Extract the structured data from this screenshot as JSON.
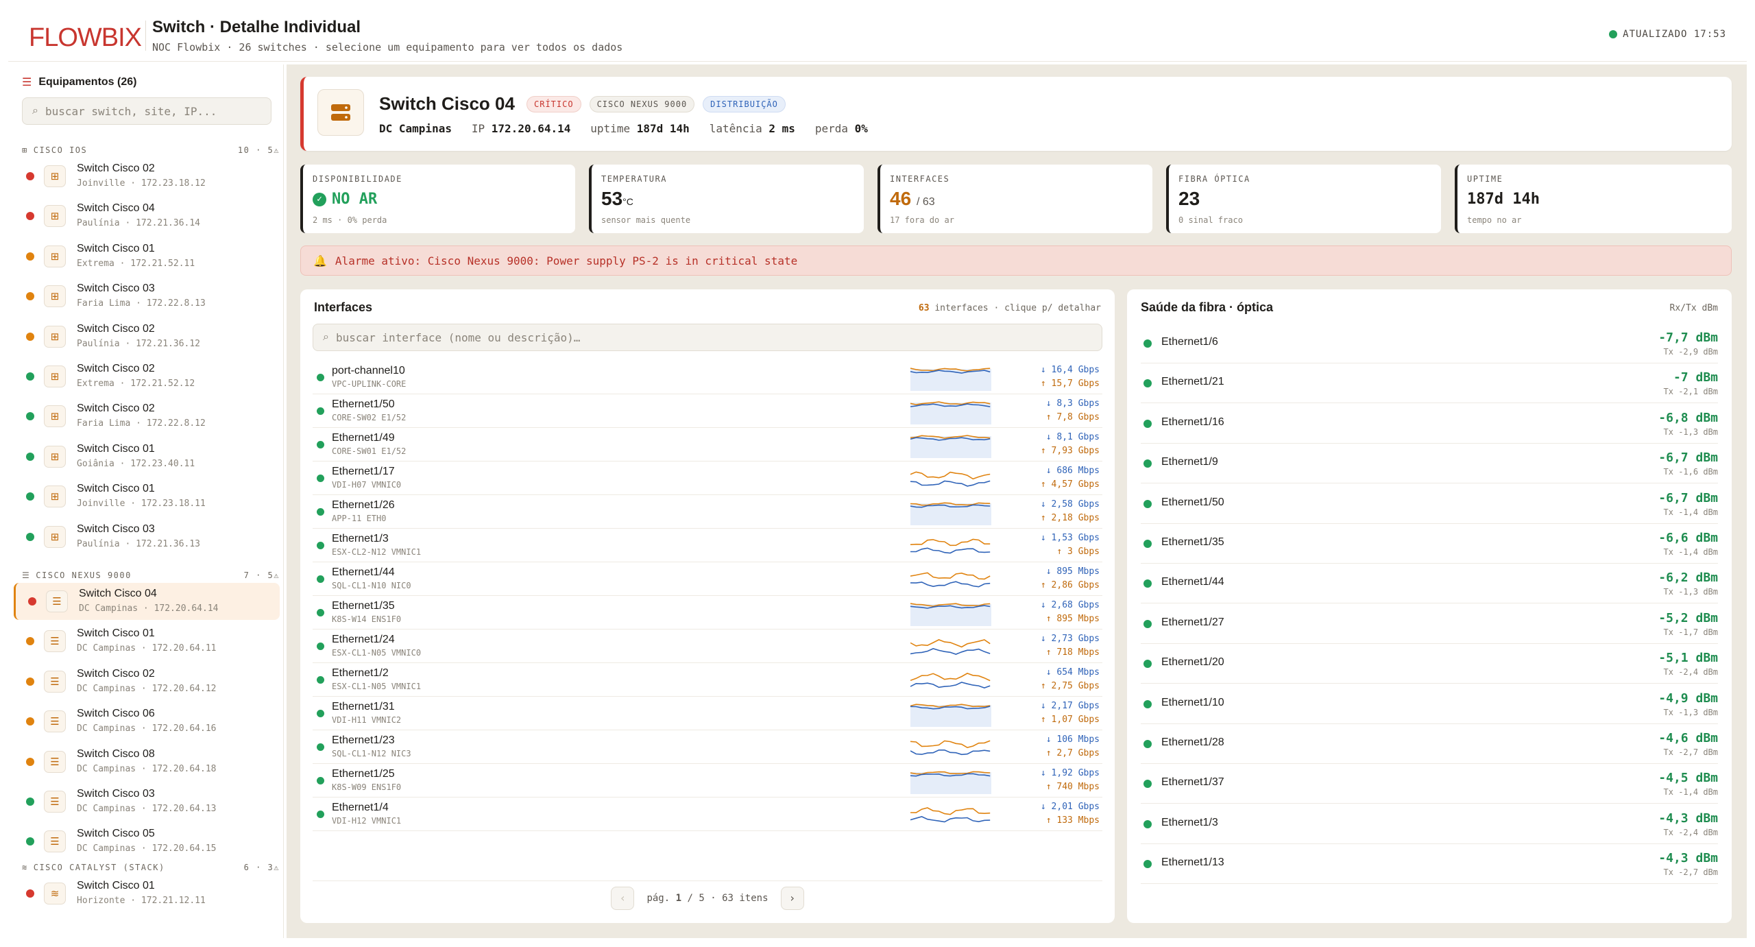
{
  "header": {
    "logo": "FLOWBIX",
    "title": "Switch · Detalhe Individual",
    "subtitle": "NOC Flowbix · 26 switches · selecione um equipamento para ver todos os dados",
    "updated": "ATUALIZADO 17:53"
  },
  "sidebar": {
    "title": "Equipamentos (26)",
    "search_placeholder": "buscar switch, site, IP...",
    "groups": [
      {
        "label": "CISCO IOS",
        "count": "10 · 5⚠",
        "icon": "network-icon",
        "items": [
          {
            "name": "Switch Cisco 02",
            "sub": "Joinville · 172.23.18.12",
            "status": "#d6392f"
          },
          {
            "name": "Switch Cisco 04",
            "sub": "Paulínia · 172.21.36.14",
            "status": "#d6392f"
          },
          {
            "name": "Switch Cisco 01",
            "sub": "Extrema · 172.21.52.11",
            "status": "#e0830f"
          },
          {
            "name": "Switch Cisco 03",
            "sub": "Faria Lima · 172.22.8.13",
            "status": "#e0830f"
          },
          {
            "name": "Switch Cisco 02",
            "sub": "Paulínia · 172.21.36.12",
            "status": "#e0830f"
          },
          {
            "name": "Switch Cisco 02",
            "sub": "Extrema · 172.21.52.12",
            "status": "#22a05b"
          },
          {
            "name": "Switch Cisco 02",
            "sub": "Faria Lima · 172.22.8.12",
            "status": "#22a05b"
          },
          {
            "name": "Switch Cisco 01",
            "sub": "Goiânia · 172.23.40.11",
            "status": "#22a05b"
          },
          {
            "name": "Switch Cisco 01",
            "sub": "Joinville · 172.23.18.11",
            "status": "#22a05b"
          },
          {
            "name": "Switch Cisco 03",
            "sub": "Paulínia · 172.21.36.13",
            "status": "#22a05b"
          }
        ]
      },
      {
        "label": "CISCO NEXUS 9000",
        "count": "7 · 5⚠",
        "icon": "server-icon",
        "items": [
          {
            "name": "Switch Cisco 04",
            "sub": "DC Campinas · 172.20.64.14",
            "status": "#d6392f",
            "selected": true
          },
          {
            "name": "Switch Cisco 01",
            "sub": "DC Campinas · 172.20.64.11",
            "status": "#e0830f"
          },
          {
            "name": "Switch Cisco 02",
            "sub": "DC Campinas · 172.20.64.12",
            "status": "#e0830f"
          },
          {
            "name": "Switch Cisco 06",
            "sub": "DC Campinas · 172.20.64.16",
            "status": "#e0830f"
          },
          {
            "name": "Switch Cisco 08",
            "sub": "DC Campinas · 172.20.64.18",
            "status": "#e0830f"
          },
          {
            "name": "Switch Cisco 03",
            "sub": "DC Campinas · 172.20.64.13",
            "status": "#22a05b"
          },
          {
            "name": "Switch Cisco 05",
            "sub": "DC Campinas · 172.20.64.15",
            "status": "#22a05b"
          }
        ]
      },
      {
        "label": "CISCO CATALYST (STACK)",
        "count": "6 · 3⚠",
        "icon": "stack-icon",
        "items": [
          {
            "name": "Switch Cisco 01",
            "sub": "Horizonte · 172.21.12.11",
            "status": "#d6392f"
          }
        ]
      }
    ]
  },
  "device": {
    "name": "Switch Cisco 04",
    "tags": [
      "CRÍTICO",
      "CISCO NEXUS 9000",
      "DISTRIBUIÇÃO"
    ],
    "site": "DC Campinas",
    "ip_label": "IP",
    "ip": "172.20.64.14",
    "uptime_label": "uptime",
    "uptime": "187d 14h",
    "latency_label": "latência",
    "latency": "2 ms",
    "loss_label": "perda",
    "loss": "0%"
  },
  "kpis": [
    {
      "label": "DISPONIBILIDADE",
      "value": "NO AR",
      "sub": "2 ms · 0% perda",
      "color": "#22a05b"
    },
    {
      "label": "TEMPERATURA",
      "value": "53",
      "unit": "°C",
      "sub": "sensor mais quente",
      "color": "#2f63b8"
    },
    {
      "label": "INTERFACES",
      "value": "46",
      "unit": "/ 63",
      "sub": "17 fora do ar",
      "color": "#e0830f"
    },
    {
      "label": "FIBRA ÓPTICA",
      "value": "23",
      "sub": "0 sinal fraco",
      "color": "#2f63b8"
    },
    {
      "label": "UPTIME",
      "value": "187d 14h",
      "sub": "tempo no ar",
      "color": "#2f63b8"
    }
  ],
  "alarm": "Alarme ativo: Cisco Nexus 9000: Power supply PS-2 is in critical state",
  "interfaces": {
    "title": "Interfaces",
    "meta_count": "63",
    "meta_text": "interfaces · clique p/ detalhar",
    "search_placeholder": "buscar interface (nome ou descrição)…",
    "rows": [
      {
        "name": "port-channel10",
        "desc": "VPC-UPLINK-CORE",
        "rx": "↓ 16,4 Gbps",
        "tx": "↑ 15,7 Gbps",
        "filled": true
      },
      {
        "name": "Ethernet1/50",
        "desc": "CORE-SW02 E1/52",
        "rx": "↓ 8,3 Gbps",
        "tx": "↑ 7,8 Gbps",
        "filled": true
      },
      {
        "name": "Ethernet1/49",
        "desc": "CORE-SW01 E1/52",
        "rx": "↓ 8,1 Gbps",
        "tx": "↑ 7,93 Gbps",
        "filled": true
      },
      {
        "name": "Ethernet1/17",
        "desc": "VDI-H07 VMNIC0",
        "rx": "↓ 686 Mbps",
        "tx": "↑ 4,57 Gbps",
        "filled": false
      },
      {
        "name": "Ethernet1/26",
        "desc": "APP-11 ETH0",
        "rx": "↓ 2,58 Gbps",
        "tx": "↑ 2,18 Gbps",
        "filled": true
      },
      {
        "name": "Ethernet1/3",
        "desc": "ESX-CL2-N12 VMNIC1",
        "rx": "↓ 1,53 Gbps",
        "tx": "↑ 3 Gbps",
        "filled": false
      },
      {
        "name": "Ethernet1/44",
        "desc": "SQL-CL1-N10 NIC0",
        "rx": "↓ 895 Mbps",
        "tx": "↑ 2,86 Gbps",
        "filled": false
      },
      {
        "name": "Ethernet1/35",
        "desc": "K8S-W14 ENS1F0",
        "rx": "↓ 2,68 Gbps",
        "tx": "↑ 895 Mbps",
        "filled": true
      },
      {
        "name": "Ethernet1/24",
        "desc": "ESX-CL1-N05 VMNIC0",
        "rx": "↓ 2,73 Gbps",
        "tx": "↑ 718 Mbps",
        "filled": false
      },
      {
        "name": "Ethernet1/2",
        "desc": "ESX-CL1-N05 VMNIC1",
        "rx": "↓ 654 Mbps",
        "tx": "↑ 2,75 Gbps",
        "filled": false
      },
      {
        "name": "Ethernet1/31",
        "desc": "VDI-H11 VMNIC2",
        "rx": "↓ 2,17 Gbps",
        "tx": "↑ 1,07 Gbps",
        "filled": true
      },
      {
        "name": "Ethernet1/23",
        "desc": "SQL-CL1-N12 NIC3",
        "rx": "↓ 106 Mbps",
        "tx": "↑ 2,7 Gbps",
        "filled": false
      },
      {
        "name": "Ethernet1/25",
        "desc": "K8S-W09 ENS1F0",
        "rx": "↓ 1,92 Gbps",
        "tx": "↑ 740 Mbps",
        "filled": true
      },
      {
        "name": "Ethernet1/4",
        "desc": "VDI-H12 VMNIC1",
        "rx": "↓ 2,01 Gbps",
        "tx": "↑ 133 Mbps",
        "filled": false
      }
    ],
    "pager": {
      "label": "pág.",
      "page": "1",
      "sep": "/",
      "total": "5",
      "items": "· 63 itens",
      "prev": "‹",
      "next": "›"
    }
  },
  "fiber": {
    "title": "Saúde da fibra · óptica",
    "meta": "Rx/Tx dBm",
    "rows": [
      {
        "name": "Ethernet1/6",
        "rx": "-7,7 dBm",
        "tx": "Tx -2,9 dBm"
      },
      {
        "name": "Ethernet1/21",
        "rx": "-7 dBm",
        "tx": "Tx -2,1 dBm"
      },
      {
        "name": "Ethernet1/16",
        "rx": "-6,8 dBm",
        "tx": "Tx -1,3 dBm"
      },
      {
        "name": "Ethernet1/9",
        "rx": "-6,7 dBm",
        "tx": "Tx -1,6 dBm"
      },
      {
        "name": "Ethernet1/50",
        "rx": "-6,7 dBm",
        "tx": "Tx -1,4 dBm"
      },
      {
        "name": "Ethernet1/35",
        "rx": "-6,6 dBm",
        "tx": "Tx -1,4 dBm"
      },
      {
        "name": "Ethernet1/44",
        "rx": "-6,2 dBm",
        "tx": "Tx -1,3 dBm"
      },
      {
        "name": "Ethernet1/27",
        "rx": "-5,2 dBm",
        "tx": "Tx -1,7 dBm"
      },
      {
        "name": "Ethernet1/20",
        "rx": "-5,1 dBm",
        "tx": "Tx -2,4 dBm"
      },
      {
        "name": "Ethernet1/10",
        "rx": "-4,9 dBm",
        "tx": "Tx -1,3 dBm"
      },
      {
        "name": "Ethernet1/28",
        "rx": "-4,6 dBm",
        "tx": "Tx -2,7 dBm"
      },
      {
        "name": "Ethernet1/37",
        "rx": "-4,5 dBm",
        "tx": "Tx -1,4 dBm"
      },
      {
        "name": "Ethernet1/3",
        "rx": "-4,3 dBm",
        "tx": "Tx -2,4 dBm"
      },
      {
        "name": "Ethernet1/13",
        "rx": "-4,3 dBm",
        "tx": "Tx -2,7 dBm"
      }
    ]
  }
}
